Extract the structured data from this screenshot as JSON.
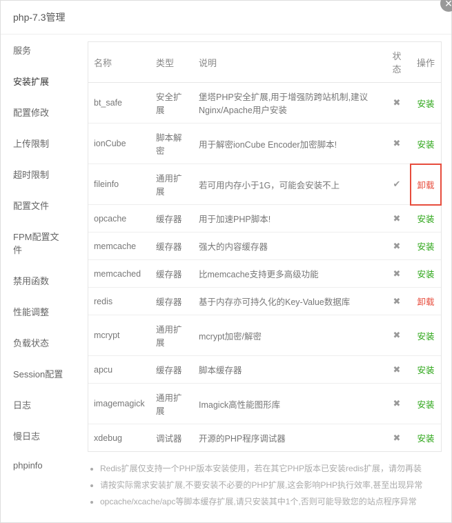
{
  "header": {
    "title": "php-7.3管理"
  },
  "sidebar": {
    "items": [
      "服务",
      "安装扩展",
      "配置修改",
      "上传限制",
      "超时限制",
      "配置文件",
      "FPM配置文件",
      "禁用函数",
      "性能调整",
      "负载状态",
      "Session配置",
      "日志",
      "慢日志",
      "phpinfo"
    ],
    "activeIndex": 1
  },
  "table": {
    "headers": {
      "name": "名称",
      "type": "类型",
      "desc": "说明",
      "status": "状态",
      "action": "操作"
    },
    "rows": [
      {
        "name": "bt_safe",
        "type": "安全扩展",
        "desc": "堡塔PHP安全扩展,用于增强防跨站机制,建议Nginx/Apache用户安装",
        "installed": false,
        "action": "安装"
      },
      {
        "name": "ionCube",
        "type": "脚本解密",
        "desc": "用于解密ionCube Encoder加密脚本!",
        "installed": false,
        "action": "安装"
      },
      {
        "name": "fileinfo",
        "type": "通用扩展",
        "desc": "若可用内存小于1G，可能会安装不上",
        "installed": true,
        "action": "卸载",
        "highlight": true
      },
      {
        "name": "opcache",
        "type": "缓存器",
        "desc": "用于加速PHP脚本!",
        "installed": false,
        "action": "安装"
      },
      {
        "name": "memcache",
        "type": "缓存器",
        "desc": "强大的内容缓存器",
        "installed": false,
        "action": "安装"
      },
      {
        "name": "memcached",
        "type": "缓存器",
        "desc": "比memcache支持更多高级功能",
        "installed": false,
        "action": "安装"
      },
      {
        "name": "redis",
        "type": "缓存器",
        "desc": "基于内存亦可持久化的Key-Value数据库",
        "installed": false,
        "action": "卸载"
      },
      {
        "name": "mcrypt",
        "type": "通用扩展",
        "desc": "mcrypt加密/解密",
        "installed": false,
        "action": "安装"
      },
      {
        "name": "apcu",
        "type": "缓存器",
        "desc": "脚本缓存器",
        "installed": false,
        "action": "安装"
      },
      {
        "name": "imagemagick",
        "type": "通用扩展",
        "desc": "Imagick高性能图形库",
        "installed": false,
        "action": "安装"
      },
      {
        "name": "xdebug",
        "type": "调试器",
        "desc": "开源的PHP程序调试器",
        "installed": false,
        "action": "安装"
      }
    ]
  },
  "notes": [
    "Redis扩展仅支持一个PHP版本安装使用，若在其它PHP版本已安装redis扩展，请勿再装",
    "请按实际需求安装扩展,不要安装不必要的PHP扩展,这会影响PHP执行效率,甚至出现异常",
    "opcache/xcache/apc等脚本缓存扩展,请只安装其中1个,否则可能导致您的站点程序异常"
  ]
}
